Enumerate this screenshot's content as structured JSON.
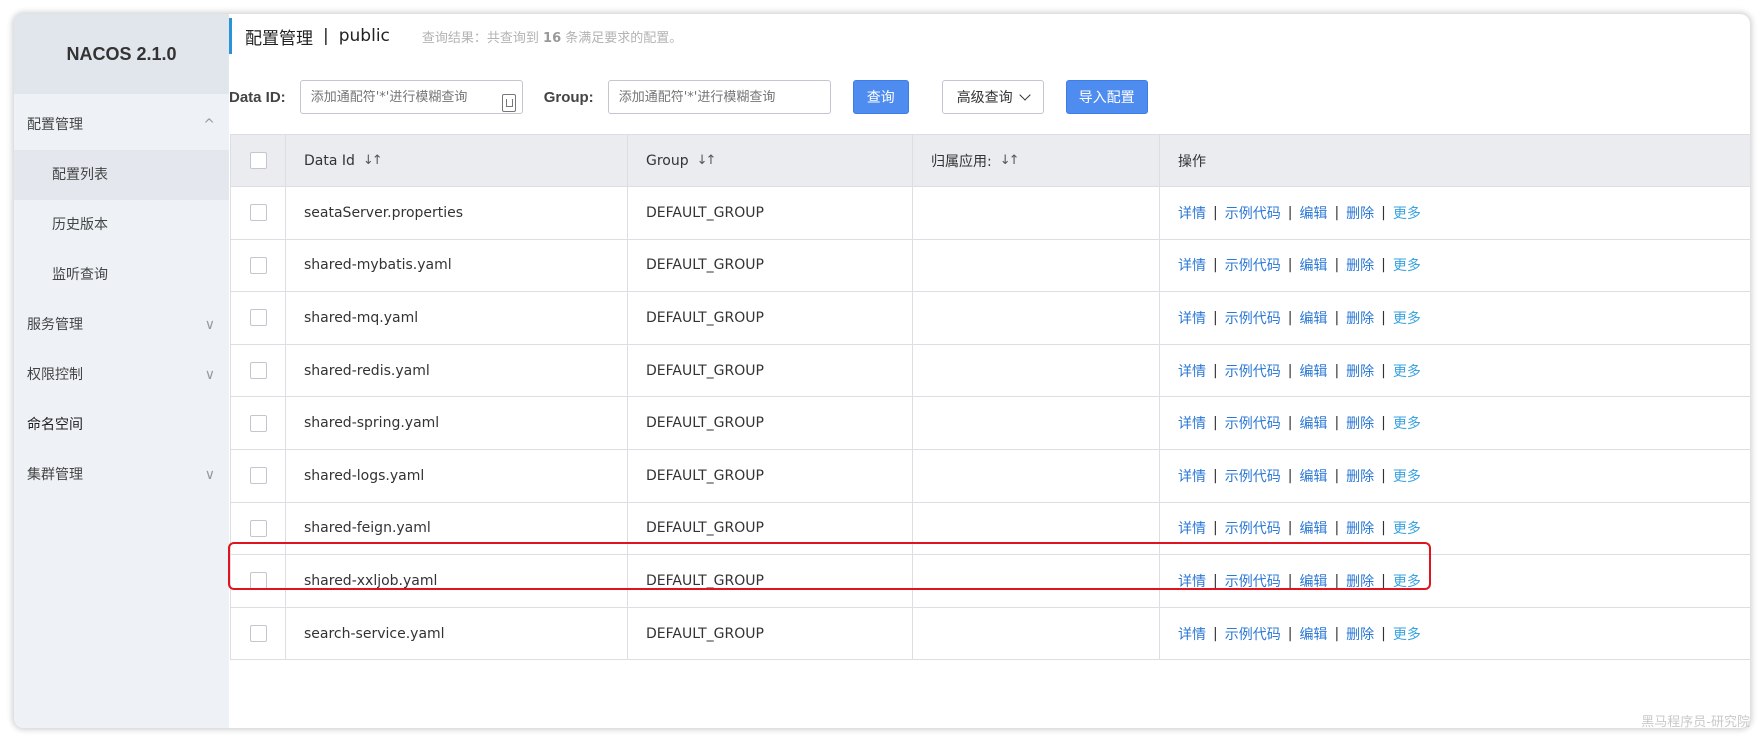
{
  "sidebar": {
    "brand": "NACOS 2.1.0",
    "items": [
      {
        "label": "配置管理",
        "arrow": "^"
      },
      {
        "label": "配置列表"
      },
      {
        "label": "历史版本"
      },
      {
        "label": "监听查询"
      },
      {
        "label": "服务管理",
        "arrow": "∨"
      },
      {
        "label": "权限控制",
        "arrow": "∨"
      },
      {
        "label": "命名空间"
      },
      {
        "label": "集群管理",
        "arrow": "∨"
      }
    ]
  },
  "header": {
    "title": "配置管理",
    "separator": "|",
    "namespace": "public",
    "result_prefix": "查询结果：共查询到",
    "result_count": "16",
    "result_suffix": "条满足要求的配置。"
  },
  "filters": {
    "dataid_label": "Data ID:",
    "dataid_placeholder": "添加通配符'*'进行模糊查询",
    "group_label": "Group:",
    "group_placeholder": "添加通配符'*'进行模糊查询",
    "search_button": "查询",
    "advanced_button": "高级查询",
    "import_button": "导入配置"
  },
  "table": {
    "columns": {
      "data_id": "Data Id",
      "group": "Group",
      "app": "归属应用:",
      "ops": "操作"
    },
    "sort_icon": "↓↑",
    "ops": {
      "detail": "详情",
      "sample": "示例代码",
      "edit": "编辑",
      "delete": "删除",
      "more": "更多",
      "sep": "|"
    },
    "rows": [
      {
        "data_id": "seataServer.properties",
        "group": "DEFAULT_GROUP",
        "app": ""
      },
      {
        "data_id": "shared-mybatis.yaml",
        "group": "DEFAULT_GROUP",
        "app": ""
      },
      {
        "data_id": "shared-mq.yaml",
        "group": "DEFAULT_GROUP",
        "app": ""
      },
      {
        "data_id": "shared-redis.yaml",
        "group": "DEFAULT_GROUP",
        "app": ""
      },
      {
        "data_id": "shared-spring.yaml",
        "group": "DEFAULT_GROUP",
        "app": ""
      },
      {
        "data_id": "shared-logs.yaml",
        "group": "DEFAULT_GROUP",
        "app": ""
      },
      {
        "data_id": "shared-feign.yaml",
        "group": "DEFAULT_GROUP",
        "app": ""
      },
      {
        "data_id": "shared-xxljob.yaml",
        "group": "DEFAULT_GROUP",
        "app": ""
      },
      {
        "data_id": "search-service.yaml",
        "group": "DEFAULT_GROUP",
        "app": ""
      }
    ]
  },
  "colors": {
    "primary": "#4f8cf0",
    "link": "#2b78d6",
    "highlight": "#e0141e"
  },
  "watermark": "黑马程序员-研究院"
}
